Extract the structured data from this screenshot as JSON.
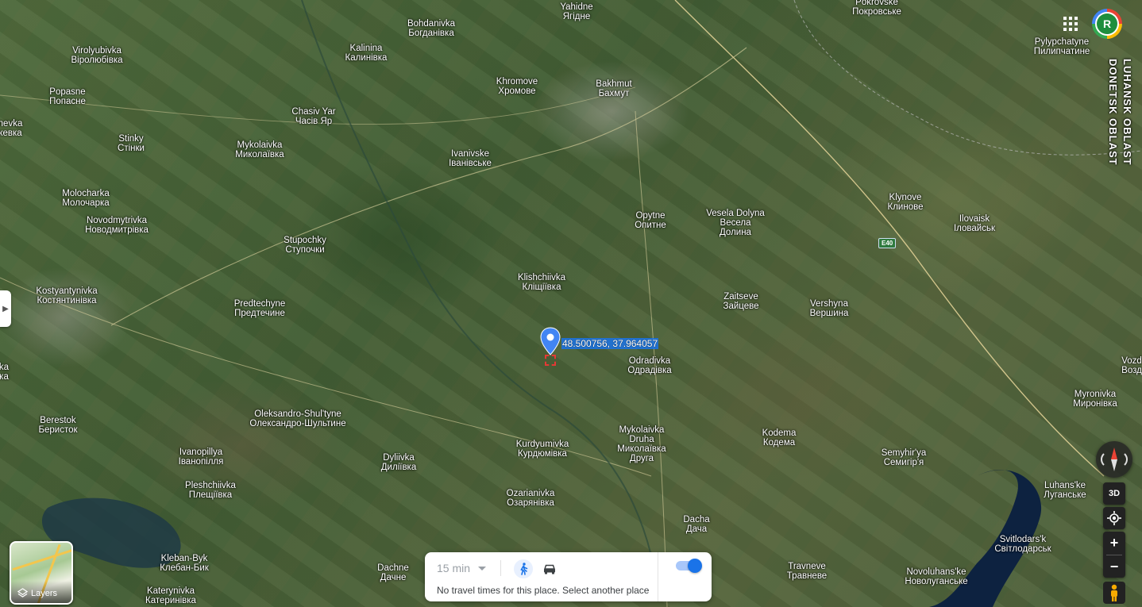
{
  "map": {
    "places": [
      {
        "id": "yahidne",
        "en": "Yahidne",
        "ua": "Ягідне"
      },
      {
        "id": "pokrovske",
        "en": "Pokrovske",
        "ua": "Покровське"
      },
      {
        "id": "bohdanivka",
        "en": "Bohdanivka",
        "ua": "Богданівка"
      },
      {
        "id": "virolyubivka",
        "en": "Virolyubivka",
        "ua": "Віролюбівка"
      },
      {
        "id": "kalinina",
        "en": "Kalinina",
        "ua": "Калинівка"
      },
      {
        "id": "pylypchatyne",
        "en": "Pylypchatyne",
        "ua": "Пилипчатине"
      },
      {
        "id": "popasne",
        "en": "Popasne",
        "ua": "Попасне"
      },
      {
        "id": "khromove",
        "en": "Khromove",
        "ua": "Хромове"
      },
      {
        "id": "bakhmut",
        "en": "Bakhmut",
        "ua": "Бахмут"
      },
      {
        "id": "chasiv-yar",
        "en": "Chasiv Yar",
        "ua": "Часів Яр"
      },
      {
        "id": "nevka",
        "en": "nevka",
        "ua": "кевка"
      },
      {
        "id": "stinky",
        "en": "Stinky",
        "ua": "Стінки"
      },
      {
        "id": "mykolaivka",
        "en": "Mykolaivka",
        "ua": "Миколаївка"
      },
      {
        "id": "ivanivske",
        "en": "Ivanivske",
        "ua": "Іванівське"
      },
      {
        "id": "molocharka",
        "en": "Molocharka",
        "ua": "Молочарка"
      },
      {
        "id": "klynove",
        "en": "Klynove",
        "ua": "Клинове"
      },
      {
        "id": "novodmytrivka",
        "en": "Novodmytrivka",
        "ua": "Новодмитрівка"
      },
      {
        "id": "opytne",
        "en": "Opytne",
        "ua": "Опитне"
      },
      {
        "id": "vesela-dolyna",
        "en": "Vesela Dolyna",
        "ua": "Весела Долина"
      },
      {
        "id": "ilovaisk",
        "en": "Ilovaisk",
        "ua": "Іловайськ"
      },
      {
        "id": "stupochky",
        "en": "Stupochky",
        "ua": "Ступочки"
      },
      {
        "id": "klishchiivka",
        "en": "Klishchiivka",
        "ua": "Кліщіївка"
      },
      {
        "id": "kostyantynivka",
        "en": "Kostyantynivka",
        "ua": "Костянтинівка"
      },
      {
        "id": "zaitseve",
        "en": "Zaitseve",
        "ua": "Зайцеве"
      },
      {
        "id": "predtechyne",
        "en": "Predtechyne",
        "ua": "Предтечине"
      },
      {
        "id": "vershyna",
        "en": "Vershyna",
        "ua": "Вершина"
      },
      {
        "id": "odradivka",
        "en": "Odradivka",
        "ua": "Одрадівка"
      },
      {
        "id": "ka",
        "en": "ka",
        "ua": "ка"
      },
      {
        "id": "vozd",
        "en": "Vozd",
        "ua": "Возд"
      },
      {
        "id": "myronivka",
        "en": "Myronivka",
        "ua": "Миронівка"
      },
      {
        "id": "berestok",
        "en": "Berestok",
        "ua": "Беристок"
      },
      {
        "id": "oleksandro",
        "en": "Oleksandro-Shul'tyne",
        "ua": "Олександро-Шультине"
      },
      {
        "id": "mykolaivka-druha",
        "en": "Mykolaivka Druha",
        "ua": "Миколаївка Друга"
      },
      {
        "id": "kodema",
        "en": "Kodema",
        "ua": "Кодема"
      },
      {
        "id": "kurdyumivka",
        "en": "Kurdyumivka",
        "ua": "Курдюмівка"
      },
      {
        "id": "ivanopillya",
        "en": "Ivanopillya",
        "ua": "Іванопілля"
      },
      {
        "id": "dyliivka",
        "en": "Dyliivka",
        "ua": "Диліївка"
      },
      {
        "id": "semyhirya",
        "en": "Semyhir'ya",
        "ua": "Семигір'я"
      },
      {
        "id": "pleshchiivka",
        "en": "Pleshchiivka",
        "ua": "Плещіївка"
      },
      {
        "id": "luhanske",
        "en": "Luhans'ke",
        "ua": "Луганське"
      },
      {
        "id": "ozarianivka",
        "en": "Ozarianivka",
        "ua": "Озарянівка"
      },
      {
        "id": "dacha",
        "en": "Dacha",
        "ua": "Дача"
      },
      {
        "id": "svitlodarsk",
        "en": "Svitlodars'k",
        "ua": "Світлодарськ"
      },
      {
        "id": "kleban-byk",
        "en": "Kleban-Byk",
        "ua": "Клебан-Бик"
      },
      {
        "id": "dachne",
        "en": "Dachne",
        "ua": "Дачне"
      },
      {
        "id": "travneve",
        "en": "Travneve",
        "ua": "Травневе"
      },
      {
        "id": "novoluhanske",
        "en": "Novoluhans'ke",
        "ua": "Новолуганське"
      },
      {
        "id": "katerynivka",
        "en": "Katerynivka",
        "ua": "Катеринівка"
      }
    ],
    "oblast_labels": [
      "LUHANSK OBLAST",
      "DONETSK OBLAST"
    ],
    "road_shield": "E40",
    "pin": {
      "coordinates": "48.500756, 37.964057",
      "color": "#4285f4"
    }
  },
  "controls": {
    "layers_label": "Layers",
    "view_3d_label": "3D",
    "zoom_in": "+",
    "zoom_out": "−",
    "avatar_initial": "R"
  },
  "travel": {
    "time": "15 min",
    "message": "No travel times for this place. Select another place",
    "accent": "#1a73e8"
  }
}
